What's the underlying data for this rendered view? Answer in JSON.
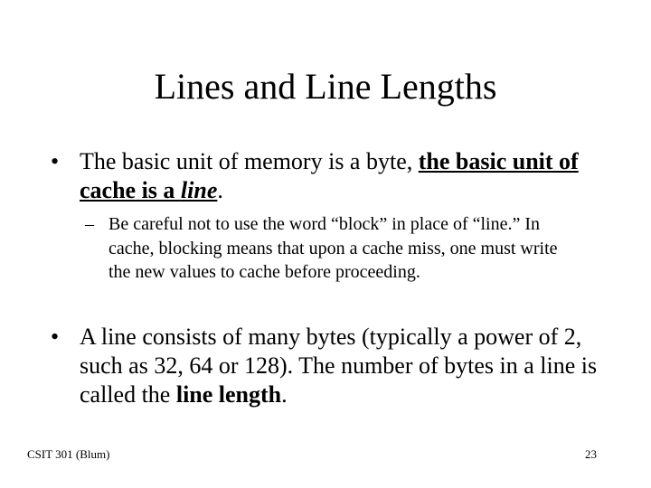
{
  "slide": {
    "title": "Lines and Line Lengths",
    "bullet_marker": "•",
    "sub_marker": "–",
    "bullet1": {
      "text_plain": "The basic unit of memory is a byte, ",
      "text_emph": "the basic unit of cache is a ",
      "text_emph_italic": "line",
      "text_end": "."
    },
    "sub1": {
      "text": "Be careful not to use the word “block” in place of “line.”  In cache, blocking means that upon a cache miss, one must write the new values to cache before proceeding."
    },
    "bullet2": {
      "text_plain": "A line consists of many bytes (typically a power of 2, such as 32, 64 or 128).  The number of bytes in a line is called the ",
      "text_bold": "line length",
      "text_end": "."
    },
    "footer": {
      "course": "CSIT 301 (Blum)",
      "page_number": "23"
    }
  }
}
